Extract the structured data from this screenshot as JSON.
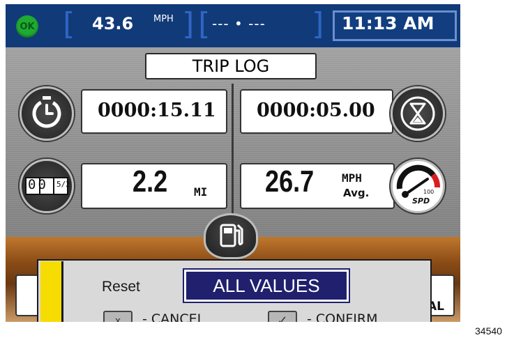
{
  "status_bar": {
    "ok_badge": "OK",
    "speed_value": "43.6",
    "speed_unit": "MPH",
    "gps_status": "--- • ---",
    "clock": "11:13 AM",
    "bracket_left": "[",
    "bracket_right": "]"
  },
  "trip_log": {
    "title": "TRIP LOG",
    "elapsed_time": "0000:15.11",
    "remaining_time": "0000:05.00",
    "trip_distance": "2.2",
    "trip_distance_unit": "MI",
    "avg_speed": "26.7",
    "avg_speed_unit": "MPH",
    "avg_speed_suffix": "Avg.",
    "odometer_digits": "00",
    "odometer_fraction": "5/2",
    "speedo_label": "SPD",
    "speedo_min": "0",
    "speedo_max": "100"
  },
  "side_text_right": "AL",
  "dialog": {
    "reset_label": "Reset",
    "selected_option": "ALL VALUES",
    "cancel_key": "x",
    "cancel_label": "- CANCEL",
    "confirm_key": "✓",
    "confirm_label": "- CONFIRM"
  },
  "figure_code": "34540",
  "colors": {
    "status_bar": "#113a78",
    "ok_badge": "#1faa32",
    "dialog_bg": "#d9d9d9",
    "dialog_accent": "#f6dc00",
    "selected_bg": "#20206e"
  },
  "icons": {
    "clock": "clock-icon",
    "hourglass": "hourglass-icon",
    "odometer": "odometer-icon",
    "speedometer": "speedometer-icon",
    "fuel": "fuel-pump-icon",
    "ok": "ok-status-icon"
  }
}
